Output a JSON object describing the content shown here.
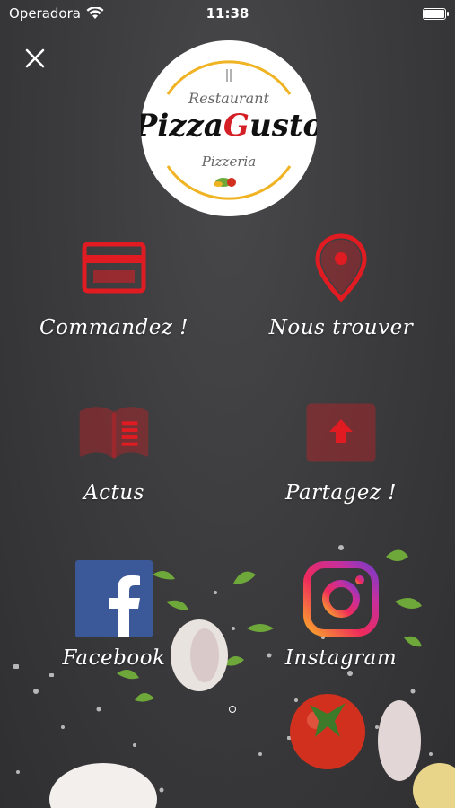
{
  "status_bar": {
    "carrier": "Operadora",
    "time": "11:38"
  },
  "logo": {
    "top_text": "Restaurant",
    "brand_part1": "Pizza",
    "brand_part2": "G",
    "brand_part3": "usto",
    "bottom_text": "Pizzeria"
  },
  "menu": [
    {
      "label": "Commandez !",
      "icon": "credit-card-icon"
    },
    {
      "label": "Nous trouver",
      "icon": "map-pin-icon"
    },
    {
      "label": "Actus",
      "icon": "open-book-icon"
    },
    {
      "label": "Partagez !",
      "icon": "share-upload-icon"
    },
    {
      "label": "Facebook",
      "icon": "facebook-icon"
    },
    {
      "label": "Instagram",
      "icon": "instagram-icon"
    }
  ],
  "colors": {
    "accent_red": "#e01b22",
    "background": "#3b3b3d",
    "facebook_blue": "#3b5998"
  }
}
